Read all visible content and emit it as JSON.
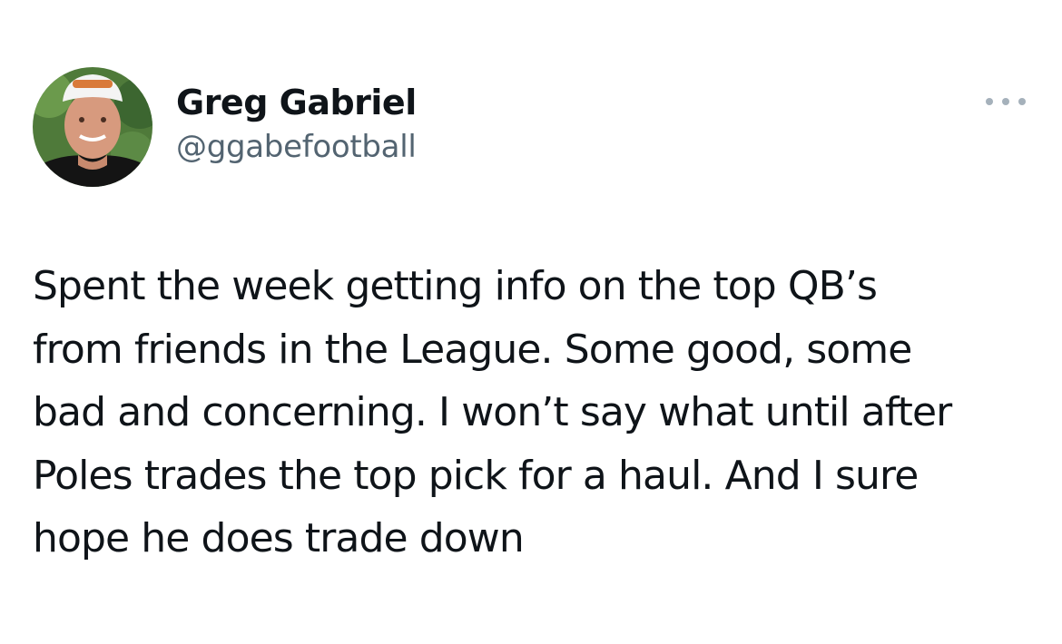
{
  "tweet": {
    "author": {
      "display_name": "Greg Gabriel",
      "handle": "@ggabefootball"
    },
    "more_icon": "more-horizontal-icon",
    "text_lines": [
      "Spent the week getting info on the top QB’s",
      "from friends in the League. Some good, some",
      "bad and concerning. I won’t say what until after",
      "Poles trades the top pick for a haul. And I sure",
      "hope he does trade down"
    ]
  },
  "colors": {
    "text_primary": "#0f1419",
    "text_secondary": "#536471",
    "icon_gray": "#a5b1bb",
    "background": "#ffffff"
  }
}
